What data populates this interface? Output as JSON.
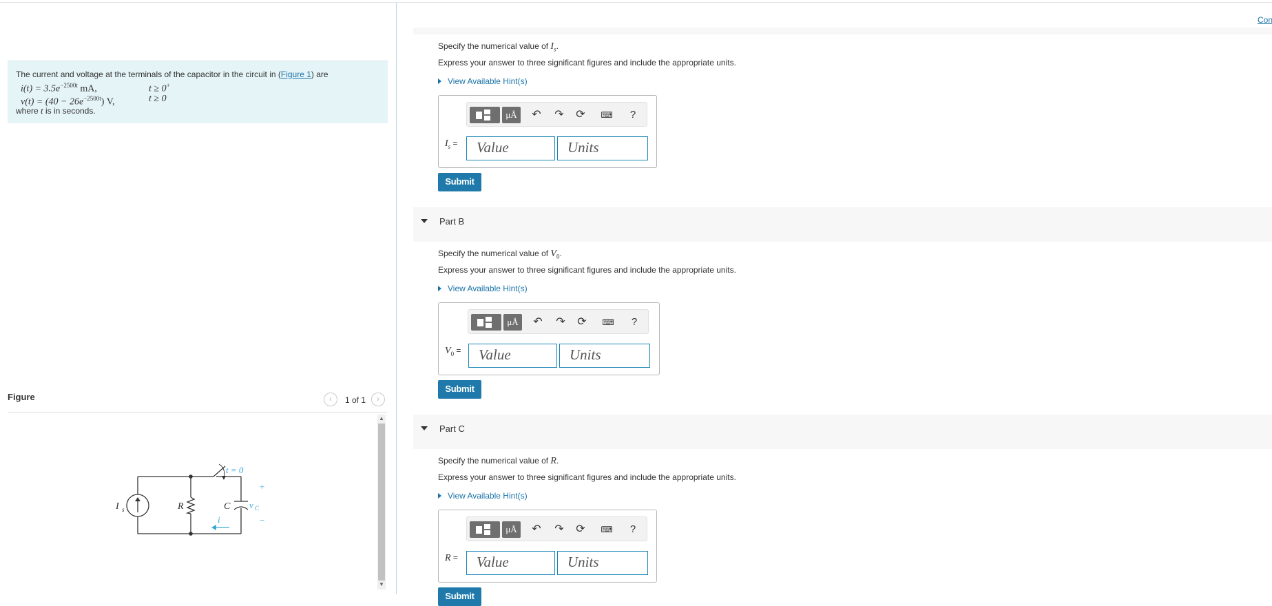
{
  "top_link": "Con",
  "problem": {
    "intro_text": "The current and voltage at the terminals of the capacitor in the circuit in (",
    "figure_link": "Figure 1",
    "intro_end": ") are",
    "eq1_lhs": "i(t) = 3.5e",
    "eq1_exp": "−2500t",
    "eq1_unit": " mA,",
    "eq1_cond": "t ≥ 0",
    "eq1_cond_sup": "+",
    "eq2_lhs": "v(t) = (40 − 26e",
    "eq2_exp": "−2500t",
    "eq2_unit": ") V,",
    "eq2_cond": "t ≥ 0",
    "where_pre": "where ",
    "where_var": "t",
    "where_post": " is in seconds."
  },
  "figure": {
    "title": "Figure",
    "counter": "1 of 1",
    "prev_icon": "chevron-left-icon",
    "next_icon": "chevron-right-icon",
    "circuit": {
      "source_label": "I",
      "source_sub": "s",
      "resistor_label": "R",
      "capacitor_label": "C",
      "switch_label": "t = 0",
      "current_label": "i",
      "voltage_label": "v",
      "voltage_sub": "C",
      "plus": "+",
      "minus": "−",
      "accent_color": "#3aa6d8"
    }
  },
  "toolbar": {
    "units_label": "μÅ",
    "help_label": "?",
    "undo_icon": "undo-icon",
    "redo_icon": "redo-icon",
    "reset_icon": "reset-icon",
    "keyboard_icon": "keyboard-icon"
  },
  "partA": {
    "spec_pre": "Specify the numerical value of ",
    "spec_var": "I",
    "spec_sub": "s",
    "spec_post": ".",
    "express": "Express your answer to three significant figures and include the appropriate units.",
    "hint": "View Available Hint(s)",
    "label_var": "I",
    "label_sub": "s",
    "label_eq": " =",
    "value_placeholder": "Value",
    "units_placeholder": "Units",
    "submit": "Submit"
  },
  "partB": {
    "title": "Part B",
    "spec_pre": "Specify the numerical value of ",
    "spec_var": "V",
    "spec_sub": "0",
    "spec_post": ".",
    "express": "Express your answer to three significant figures and include the appropriate units.",
    "hint": "View Available Hint(s)",
    "label_var": "V",
    "label_sub": "0",
    "label_eq": " =",
    "value_placeholder": "Value",
    "units_placeholder": "Units",
    "submit": "Submit"
  },
  "partC": {
    "title": "Part C",
    "spec_pre": "Specify the numerical value of ",
    "spec_var": "R",
    "spec_post": ".",
    "express": "Express your answer to three significant figures and include the appropriate units.",
    "hint": "View Available Hint(s)",
    "label_var": "R",
    "label_eq": " =",
    "value_placeholder": "Value",
    "units_placeholder": "Units",
    "submit": "Submit"
  }
}
